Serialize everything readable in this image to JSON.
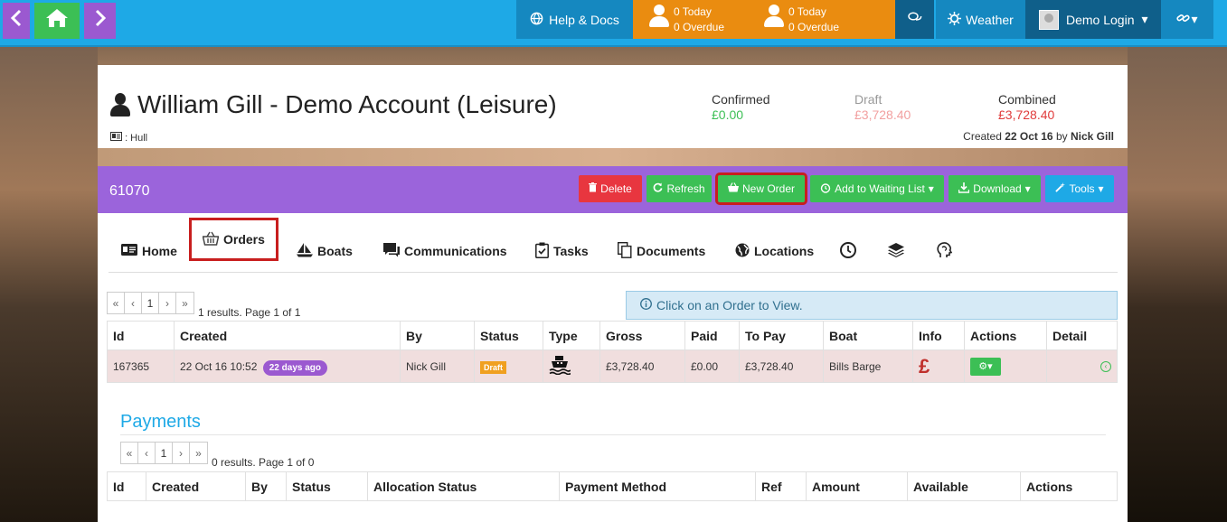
{
  "topbar": {
    "back_icon": "chevron-left",
    "home_icon": "home",
    "forward_icon": "chevron-right",
    "help_label": "Help & Docs",
    "tasks_mine": {
      "today": "0 Today",
      "overdue": "0 Overdue"
    },
    "tasks_all": {
      "today": "0 Today",
      "overdue": "0 Overdue"
    },
    "weather_label": "Weather",
    "login_label": "Demo Login"
  },
  "account": {
    "title": "William Gill - Demo Account (Leisure)",
    "location": ": Hull",
    "confirmed_label": "Confirmed",
    "confirmed_value": "£0.00",
    "draft_label": "Draft",
    "draft_value": "£3,728.40",
    "combined_label": "Combined",
    "combined_value": "£3,728.40",
    "created_prefix": "Created",
    "created_date": "22 Oct 16",
    "created_by_prefix": "by",
    "created_by": "Nick Gill"
  },
  "panel": {
    "order_id": "61070",
    "buttons": {
      "delete": "Delete",
      "refresh": "Refresh",
      "new_order": "New Order",
      "waiting_list": "Add to Waiting List",
      "download": "Download",
      "tools": "Tools"
    }
  },
  "tabs": {
    "home": "Home",
    "orders": "Orders",
    "boats": "Boats",
    "communications": "Communications",
    "tasks": "Tasks",
    "documents": "Documents",
    "locations": "Locations"
  },
  "orders": {
    "pager": [
      "«",
      "‹",
      "1",
      "›",
      "»"
    ],
    "results": "1 results. Page 1 of 1",
    "hint": "Click on an Order to View.",
    "columns": [
      "Id",
      "Created",
      "By",
      "Status",
      "Type",
      "Gross",
      "Paid",
      "To Pay",
      "Boat",
      "Info",
      "Actions",
      "Detail"
    ],
    "rows": [
      {
        "id": "167365",
        "created": "22 Oct 16 10:52",
        "age": "22 days ago",
        "by": "Nick Gill",
        "status": "Draft",
        "type_icon": "boat",
        "gross": "£3,728.40",
        "paid": "£0.00",
        "to_pay": "£3,728.40",
        "boat": "Bills Barge",
        "info": "£"
      }
    ]
  },
  "payments": {
    "title": "Payments",
    "pager": [
      "«",
      "‹",
      "1",
      "›",
      "»"
    ],
    "results": "0 results. Page 1 of 0",
    "columns": [
      "Id",
      "Created",
      "By",
      "Status",
      "Allocation Status",
      "Payment Method",
      "Ref",
      "Amount",
      "Available",
      "Actions"
    ]
  },
  "colors": {
    "topbar": "#1ea9e6",
    "tasks_bg": "#ea8c10",
    "panel_header": "#9b64db",
    "success": "#3cbf55",
    "danger": "#e8363f",
    "highlight": "#c81e1e"
  }
}
